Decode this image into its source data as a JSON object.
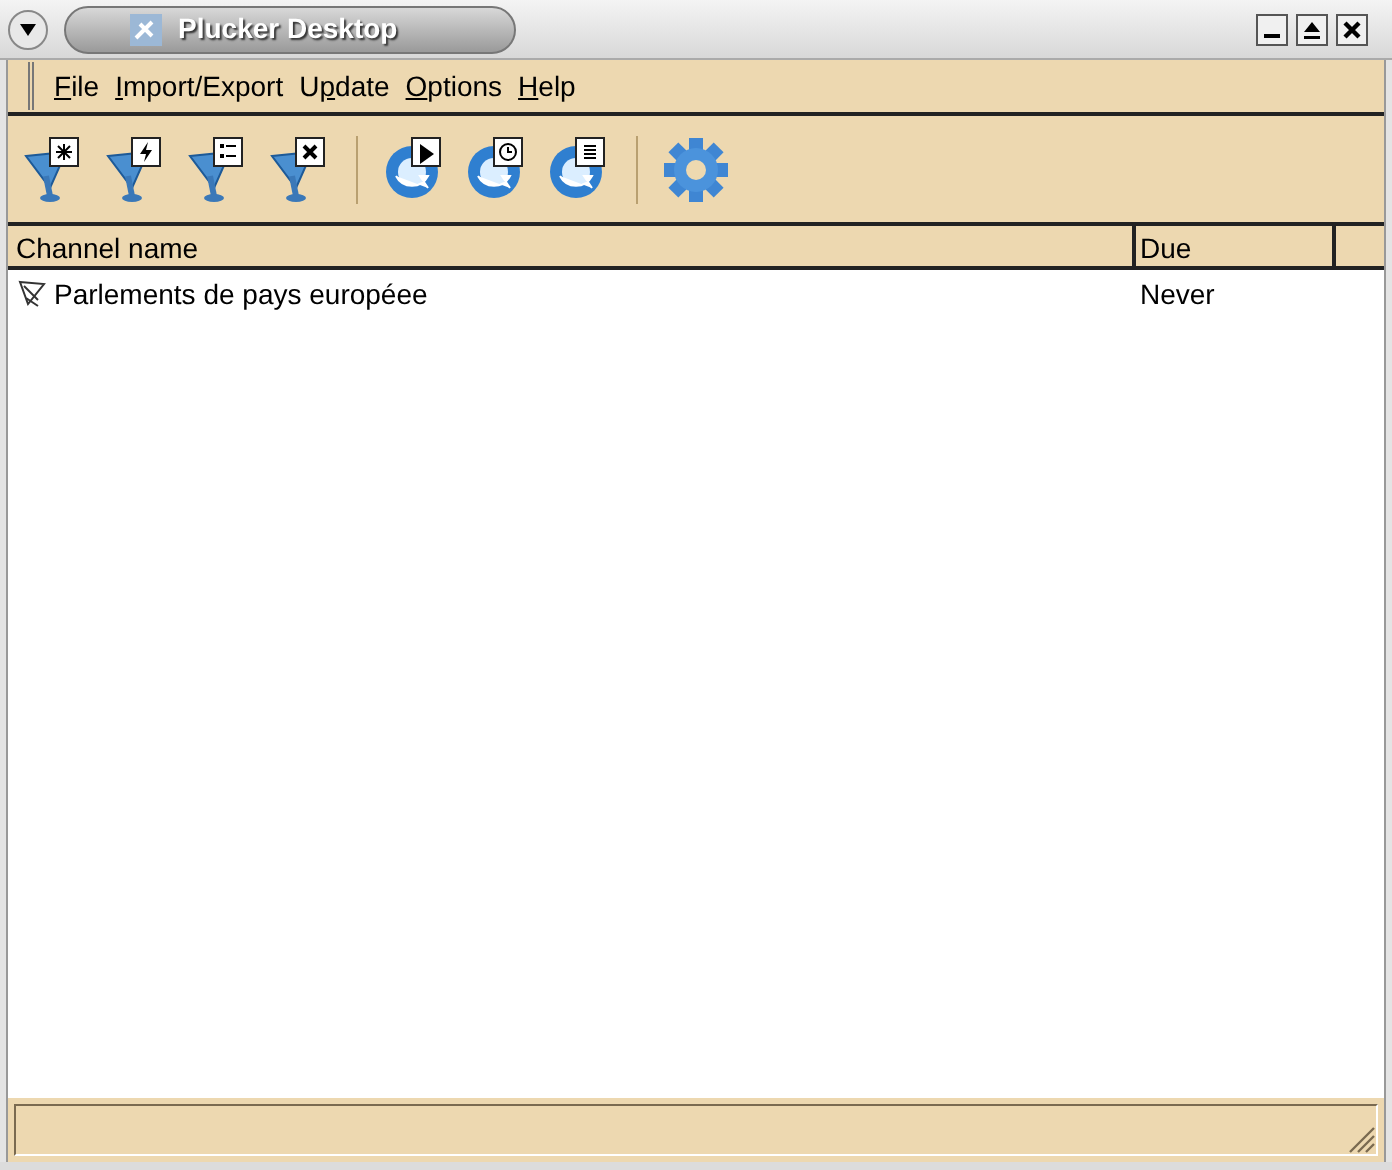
{
  "window": {
    "title": "Plucker Desktop"
  },
  "menu": [
    {
      "key": "F",
      "after": "ile"
    },
    {
      "key": "I",
      "after": "mport/Export"
    },
    {
      "before": "U",
      "key": "p",
      "after": "date"
    },
    {
      "key": "O",
      "after": "ptions"
    },
    {
      "key": "H",
      "after": "elp"
    }
  ],
  "toolbar": [
    {
      "kind": "new"
    },
    {
      "kind": "bolt"
    },
    {
      "kind": "list"
    },
    {
      "kind": "delete"
    },
    {
      "kind": "separator"
    },
    {
      "kind": "play"
    },
    {
      "kind": "clock"
    },
    {
      "kind": "doc"
    },
    {
      "kind": "separator"
    },
    {
      "kind": "gear"
    }
  ],
  "table": {
    "columns": [
      "Channel name",
      "Due"
    ],
    "rows": [
      {
        "name": "Parlements de pays européee",
        "due": "Never"
      }
    ]
  }
}
